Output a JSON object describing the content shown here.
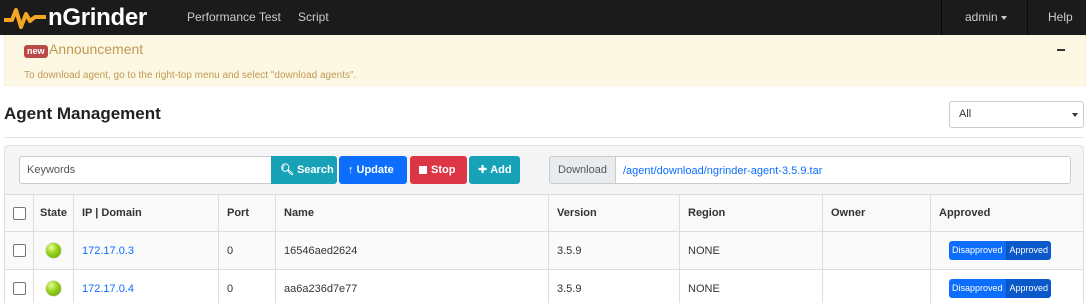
{
  "navbar": {
    "brand": "nGrinder",
    "links": [
      "Performance Test",
      "Script"
    ],
    "user": "admin",
    "help": "Help"
  },
  "announcement": {
    "badge": "new",
    "title": "Announcement",
    "text": "To download agent, go to the right-top menu and select \"download agents\"."
  },
  "page": {
    "title": "Agent Management",
    "filter_selected": "All"
  },
  "toolbar": {
    "search_placeholder": "Keywords",
    "search_label": "Search",
    "update_label": "Update",
    "stop_label": "Stop",
    "add_label": "Add",
    "download_label": "Download",
    "download_link": "/agent/download/ngrinder-agent-3.5.9.tar"
  },
  "table": {
    "headers": [
      "State",
      "IP | Domain",
      "Port",
      "Name",
      "Version",
      "Region",
      "Owner",
      "Approved"
    ],
    "rows": [
      {
        "ip": "172.17.0.3",
        "port": "0",
        "name": "16546aed2624",
        "version": "3.5.9",
        "region": "NONE",
        "owner": "",
        "disapproved": "Disapproved",
        "approved": "Approved"
      },
      {
        "ip": "172.17.0.4",
        "port": "0",
        "name": "aa6a236d7e77",
        "version": "3.5.9",
        "region": "NONE",
        "owner": "",
        "disapproved": "Disapproved",
        "approved": "Approved"
      }
    ]
  },
  "colors": {
    "navbar_bg": "#1b1b1b",
    "brand_orange": "#f5a623",
    "announce_bg": "#fcf8e3",
    "info": "#17a2b8",
    "primary": "#0d6efd",
    "danger": "#dc3545",
    "state_ready": "#9bd51f"
  }
}
